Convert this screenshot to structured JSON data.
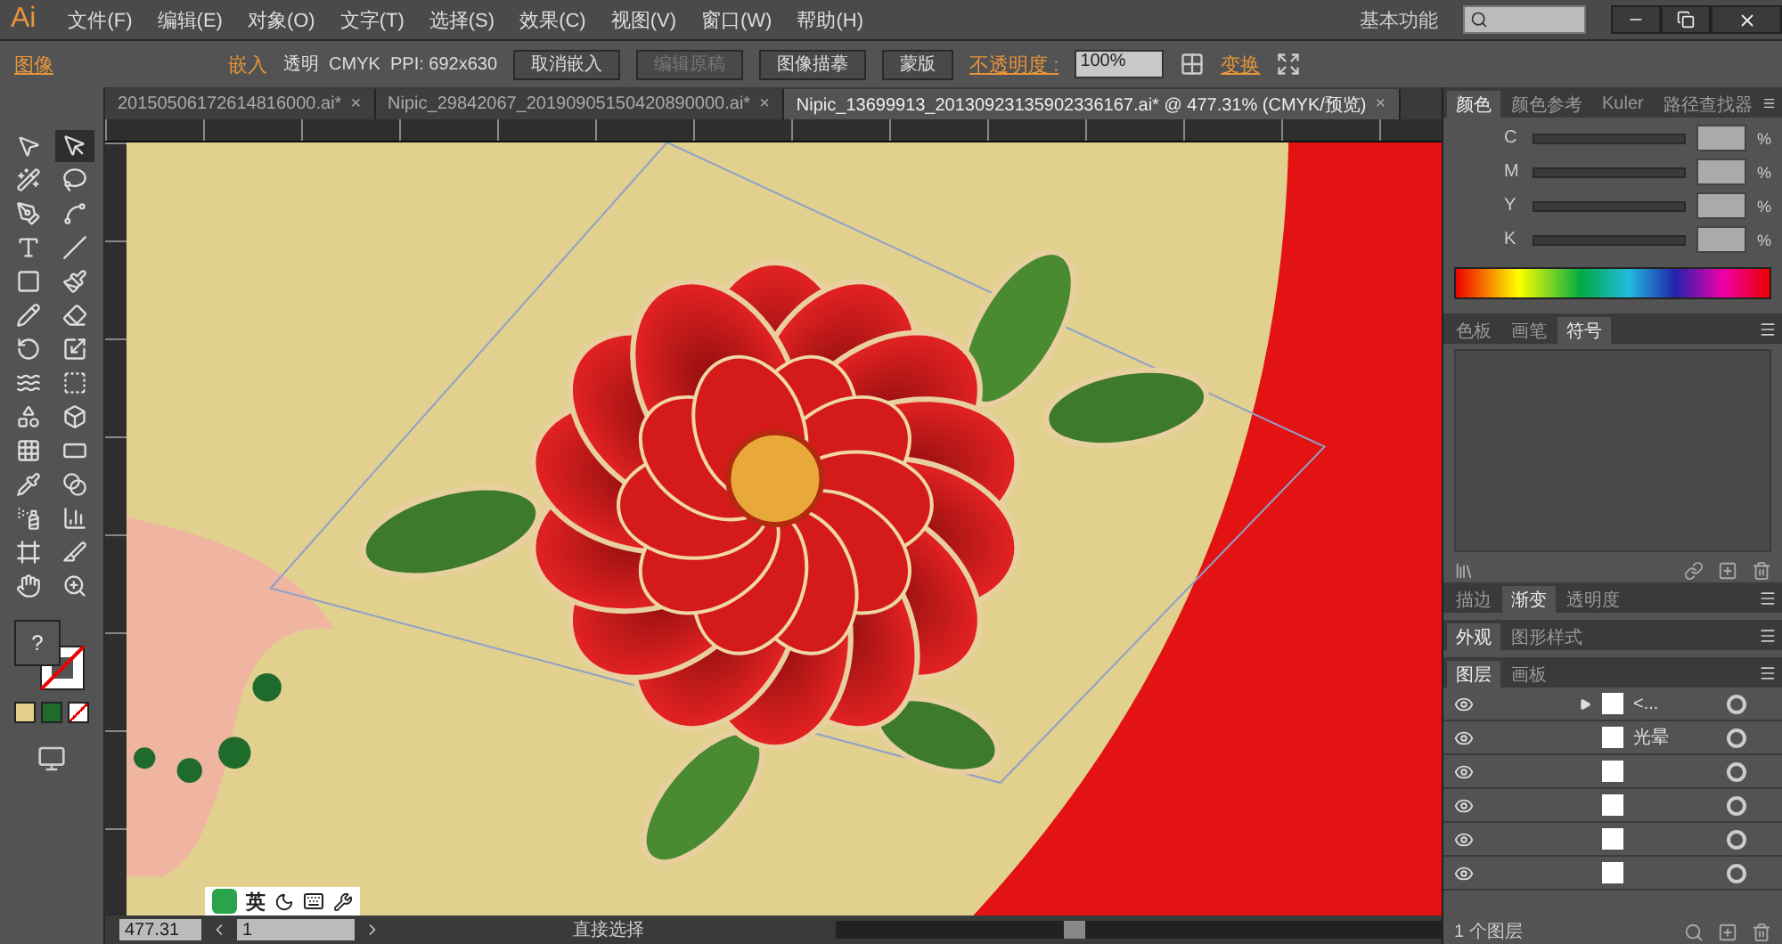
{
  "app": {
    "logo": "Ai",
    "menus": [
      "文件(F)",
      "编辑(E)",
      "对象(O)",
      "文字(T)",
      "选择(S)",
      "效果(C)",
      "视图(V)",
      "窗口(W)",
      "帮助(H)"
    ],
    "workspace": "基本功能"
  },
  "control_bar": {
    "object_type": "图像",
    "embed_label": "嵌入",
    "info": "透明  CMYK  PPI: 692x630",
    "buttons": [
      {
        "label": "取消嵌入",
        "disabled": false
      },
      {
        "label": "编辑原稿",
        "disabled": true
      },
      {
        "label": "图像描摹",
        "disabled": false
      },
      {
        "label": "蒙版",
        "disabled": false
      }
    ],
    "opacity_label": "不透明度 :",
    "opacity": "100%",
    "transform_label": "变换"
  },
  "documents": [
    {
      "title": "20150506172614816000.ai*",
      "close": "×",
      "selected": false
    },
    {
      "title": "Nipic_29842067_20190905150420890000.ai*",
      "close": "×",
      "selected": false
    },
    {
      "title": "Nipic_13699913_20130923135902336167.ai* @ 477.31% (CMYK/预览)",
      "close": "×",
      "selected": true
    }
  ],
  "tools": [
    {
      "selected": false
    },
    {
      "selected": true
    },
    {
      "selected": false
    },
    {
      "selected": false
    },
    {
      "selected": false
    },
    {
      "selected": false
    },
    {
      "selected": false
    },
    {
      "selected": false
    },
    {
      "selected": false
    },
    {
      "selected": false
    },
    {
      "selected": false
    },
    {
      "selected": false
    },
    {
      "selected": false
    },
    {
      "selected": false
    },
    {
      "selected": false
    },
    {
      "selected": false
    },
    {
      "selected": false
    },
    {
      "selected": false
    },
    {
      "selected": false
    },
    {
      "selected": false
    },
    {
      "selected": false
    },
    {
      "selected": false
    },
    {
      "selected": false
    },
    {
      "selected": false
    },
    {
      "selected": false
    },
    {
      "selected": false
    },
    {
      "selected": false
    },
    {
      "selected": false
    }
  ],
  "fill_stroke": {
    "fill": "?"
  },
  "color_panel": {
    "tabs": [
      {
        "label": "颜色",
        "selected": true
      },
      {
        "label": "颜色参考",
        "selected": false
      },
      {
        "label": "Kuler",
        "selected": false
      },
      {
        "label": "路径查找器",
        "selected": false
      }
    ],
    "channels": [
      {
        "name": "C",
        "level": 0
      },
      {
        "name": "M",
        "level": 0
      },
      {
        "name": "Y",
        "level": 0
      },
      {
        "name": "K",
        "level": 0
      }
    ],
    "unit": "%"
  },
  "symbols_panel": {
    "tabs": [
      {
        "label": "色板",
        "selected": false
      },
      {
        "label": "画笔",
        "selected": false
      },
      {
        "label": "符号",
        "selected": true
      }
    ]
  },
  "gradient_panel": {
    "tabs": [
      {
        "label": "描边",
        "selected": false
      },
      {
        "label": "渐变",
        "selected": true
      },
      {
        "label": "透明度",
        "selected": false
      }
    ]
  },
  "appearance_panel": {
    "tabs": [
      {
        "label": "外观",
        "selected": true
      },
      {
        "label": "图形样式",
        "selected": false
      }
    ]
  },
  "layers_panel": {
    "tabs": [
      {
        "label": "图层",
        "selected": true
      },
      {
        "label": "画板",
        "selected": false
      }
    ],
    "rows": [
      {
        "name": "<...",
        "expandable": true
      },
      {
        "name": "光晕",
        "expandable": false
      },
      {
        "expandable": false
      },
      {
        "expandable": false
      },
      {
        "expandable": false
      },
      {
        "expandable": false
      }
    ],
    "footer": "1 个图层"
  },
  "status_bar": {
    "zoom": "477.31",
    "artboard": "1",
    "tool": "直接选择"
  },
  "ime_bar": {
    "mode": "英"
  }
}
